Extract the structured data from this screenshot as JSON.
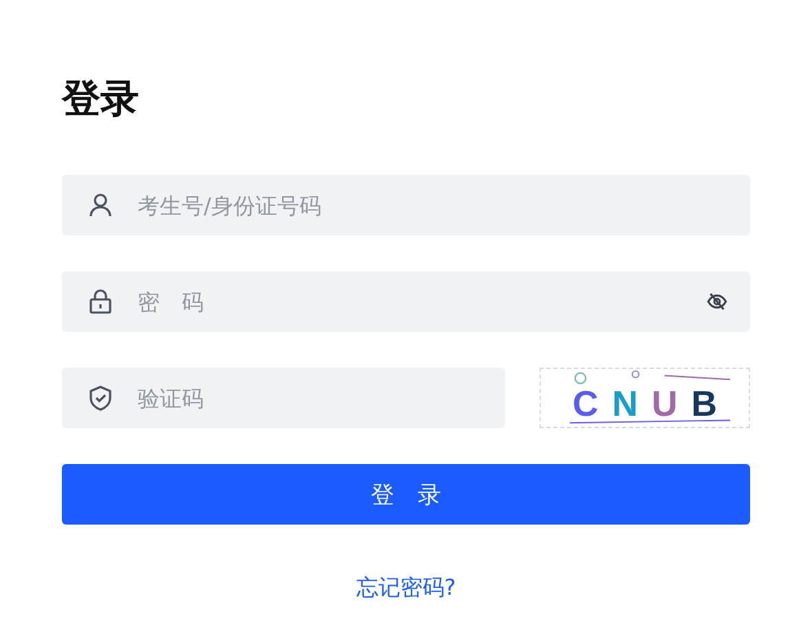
{
  "title": "登录",
  "fields": [
    {
      "kind": "user",
      "placeholder": "考生号/身份证号码"
    },
    {
      "kind": "password",
      "placeholder": "密　码",
      "password_visible": false
    },
    {
      "kind": "captcha",
      "placeholder": "验证码"
    }
  ],
  "captcha": {
    "letters": [
      {
        "char": "C",
        "color": "#5b5cf0"
      },
      {
        "char": "N",
        "color": "#1a9ccc"
      },
      {
        "char": "U",
        "color": "#a06aa8"
      },
      {
        "char": "B",
        "color": "#16375e"
      }
    ]
  },
  "submit": "登　录",
  "forgot_link": "忘记密码?"
}
